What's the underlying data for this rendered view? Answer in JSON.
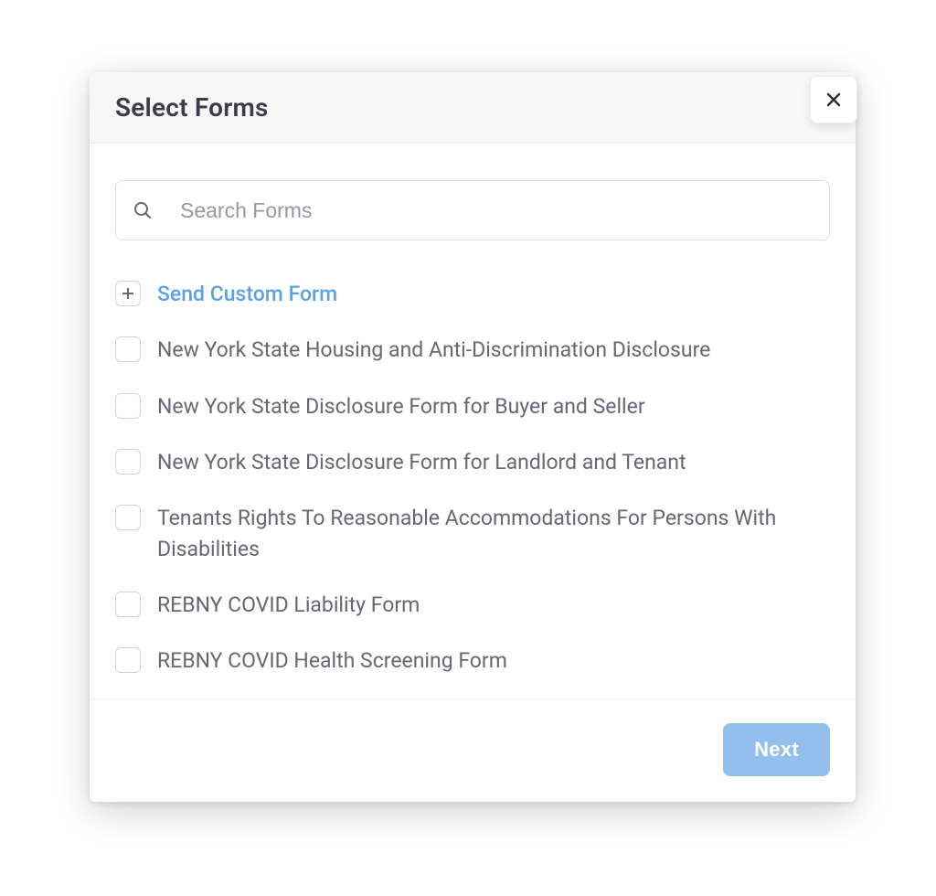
{
  "modal": {
    "title": "Select Forms",
    "close_icon": "close"
  },
  "search": {
    "placeholder": "Search Forms",
    "value": "",
    "icon": "search"
  },
  "custom_form": {
    "label": "Send Custom Form",
    "icon": "plus"
  },
  "forms": [
    {
      "label": "New York State Housing and Anti-Discrimination Disclosure",
      "checked": false
    },
    {
      "label": "New York State Disclosure Form for Buyer and Seller",
      "checked": false
    },
    {
      "label": "New York State Disclosure Form for Landlord and Tenant",
      "checked": false
    },
    {
      "label": "Tenants Rights To Reasonable Accommodations For Persons With Disabilities",
      "checked": false
    },
    {
      "label": "REBNY COVID Liability Form",
      "checked": false
    },
    {
      "label": "REBNY COVID Health Screening Form",
      "checked": false
    }
  ],
  "footer": {
    "next_label": "Next"
  },
  "colors": {
    "accent": "#5aa2e8",
    "button": "#93bfee",
    "text_primary": "#3f3a4a",
    "text_secondary": "#6a6575",
    "border": "#dedde2"
  }
}
